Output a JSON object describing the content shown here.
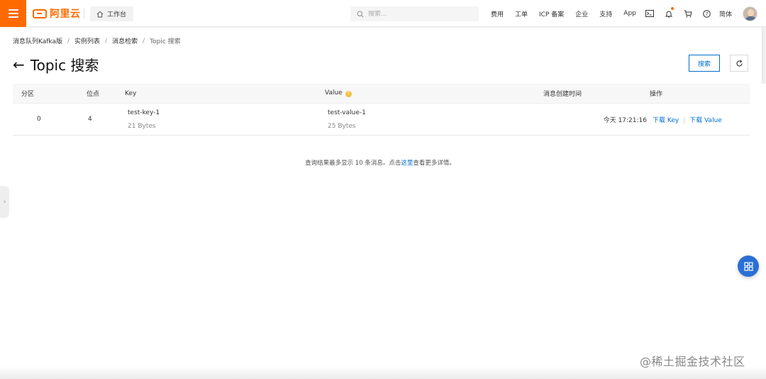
{
  "topbar": {
    "brand": "阿里云",
    "workbench": "工作台",
    "search_placeholder": "搜索...",
    "nav": [
      "费用",
      "工单",
      "ICP 备案",
      "企业",
      "支持",
      "App"
    ],
    "lang": "简体",
    "brand_color": "#ff6a00"
  },
  "breadcrumb": [
    "消息队列Kafka版",
    "实例列表",
    "消息检索",
    "Topic 搜索"
  ],
  "page": {
    "back_arrow": "←",
    "title": "Topic 搜索",
    "search_button": "搜索"
  },
  "table": {
    "headers": [
      "分区",
      "位点",
      "Key",
      "Value",
      "消息创建时间",
      "操作"
    ],
    "rows": [
      {
        "partition": "0",
        "offset": "4",
        "key": "test-key-1",
        "key_size": "21 Bytes",
        "value": "test-value-1",
        "value_size": "25 Bytes",
        "created": "今天 17:21:16",
        "op_key": "下载 Key",
        "op_value": "下载 Value"
      }
    ]
  },
  "note": {
    "before": "查询结果最多显示 10 条消息。点击",
    "link": "这里",
    "after": "查看更多详情。"
  },
  "watermark": "@稀土掘金技术社区",
  "accent_color": "#0070cc"
}
